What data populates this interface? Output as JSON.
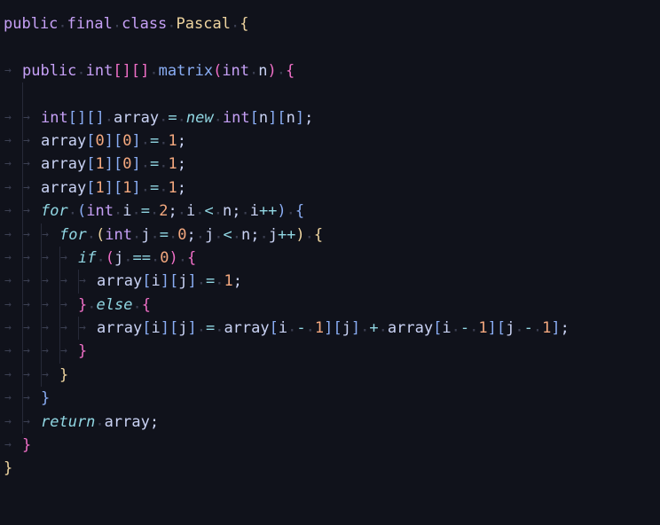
{
  "editor": {
    "language": "java",
    "colors": {
      "background": "#10121b",
      "keyword": "#c6a0f6",
      "class": "#eed49f",
      "function": "#8aadf4",
      "number": "#f5a97f",
      "operator": "#91d7e3"
    },
    "lines": [
      {
        "indent": 0,
        "text": "public final class Pascal {"
      },
      {
        "indent": 1,
        "text": "",
        "empty": true
      },
      {
        "indent": 1,
        "text": "public int[][] matrix(int n) {"
      },
      {
        "indent": 2,
        "text": "",
        "empty": true
      },
      {
        "indent": 2,
        "text": "int[][] array = new int[n][n];"
      },
      {
        "indent": 2,
        "text": "array[0][0] = 1;"
      },
      {
        "indent": 2,
        "text": "array[1][0] = 1;"
      },
      {
        "indent": 2,
        "text": "array[1][1] = 1;"
      },
      {
        "indent": 2,
        "text": "for (int i = 2; i < n; i++) {"
      },
      {
        "indent": 3,
        "text": "for (int j = 0; j < n; j++) {"
      },
      {
        "indent": 4,
        "text": "if (j == 0) {"
      },
      {
        "indent": 5,
        "text": "array[i][j] = 1;"
      },
      {
        "indent": 4,
        "text": "} else {"
      },
      {
        "indent": 5,
        "text": "array[i][j] = array[i - 1][j] + array[i - 1][j - 1];"
      },
      {
        "indent": 4,
        "text": "}"
      },
      {
        "indent": 3,
        "text": "}"
      },
      {
        "indent": 2,
        "text": "}"
      },
      {
        "indent": 2,
        "text": "return array;"
      },
      {
        "indent": 1,
        "text": "}"
      },
      {
        "indent": 0,
        "text": "}"
      }
    ]
  }
}
